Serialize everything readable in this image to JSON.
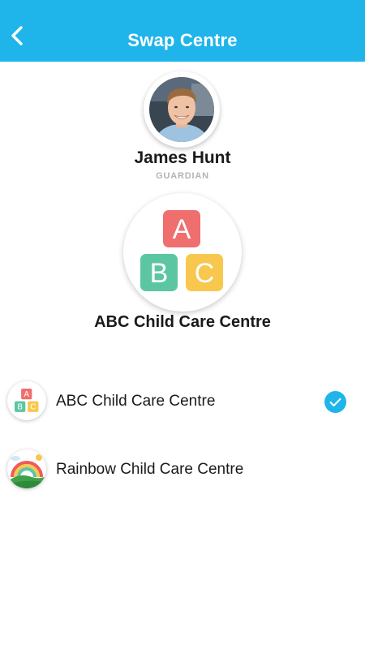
{
  "header": {
    "title": "Swap Centre",
    "back_icon": "chevron-left-icon",
    "background": "#1fb5ea"
  },
  "profile": {
    "name": "James Hunt",
    "role": "GUARDIAN"
  },
  "selected_centre": {
    "name": "ABC Child Care Centre",
    "logo_letters": [
      "A",
      "B",
      "C"
    ]
  },
  "centres": [
    {
      "name": "ABC Child Care Centre",
      "logo": "abc-blocks-icon",
      "selected": true
    },
    {
      "name": "Rainbow Child Care Centre",
      "logo": "rainbow-icon",
      "selected": false
    }
  ],
  "colors": {
    "accent": "#1fb5ea",
    "block_a": "#ef6f6f",
    "block_b": "#5cc6a3",
    "block_c": "#f8c84e"
  }
}
